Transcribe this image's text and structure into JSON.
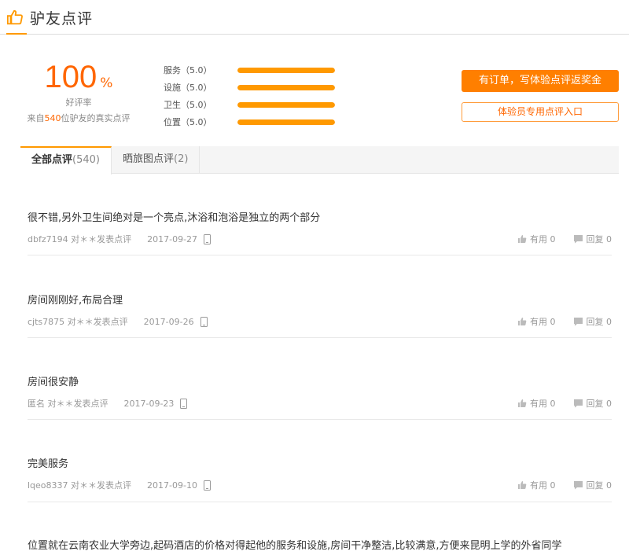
{
  "header": {
    "title": "驴友点评",
    "icon": "thumbs-up-icon",
    "accent_color": "#ff9900"
  },
  "summary": {
    "score": "100",
    "percent_sign": "%",
    "rate_label": "好评率",
    "from_prefix": "来自",
    "from_count": "540",
    "from_suffix": "位驴友的真实点评"
  },
  "ratings": [
    {
      "label": "服务（5.0）",
      "value": 5.0,
      "max": 5
    },
    {
      "label": "设施（5.0）",
      "value": 5.0,
      "max": 5
    },
    {
      "label": "卫生（5.0）",
      "value": 5.0,
      "max": 5
    },
    {
      "label": "位置（5.0）",
      "value": 5.0,
      "max": 5
    }
  ],
  "buttons": {
    "order_review": "有订单，写体验点评返奖金",
    "tester_entry": "体验员专用点评入口"
  },
  "tabs": [
    {
      "label": "全部点评",
      "count": "(540)",
      "active": true
    },
    {
      "label": "晒旅图点评",
      "count": "(2)",
      "active": false
    }
  ],
  "reviews": [
    {
      "text": "很不错,另外卫生间绝对是一个亮点,沐浴和泡浴是独立的两个部分",
      "author": "dbfz7194 对＊＊发表点评",
      "date": "2017-09-27",
      "useful": "有用 0",
      "reply": "回复 0"
    },
    {
      "text": "房间刚刚好,布局合理",
      "author": "cjts7875 对＊＊发表点评",
      "date": "2017-09-26",
      "useful": "有用 0",
      "reply": "回复 0"
    },
    {
      "text": "房间很安静",
      "author": "匿名 对＊＊发表点评",
      "date": "2017-09-23",
      "useful": "有用 0",
      "reply": "回复 0"
    },
    {
      "text": "完美服务",
      "author": "lqeo8337 对＊＊发表点评",
      "date": "2017-09-10",
      "useful": "有用 0",
      "reply": "回复 0"
    },
    {
      "text": "位置就在云南农业大学旁边,起码酒店的价格对得起他的服务和设施,房间干净整洁,比较满意,方便来昆明上学的外省同学"
    }
  ]
}
